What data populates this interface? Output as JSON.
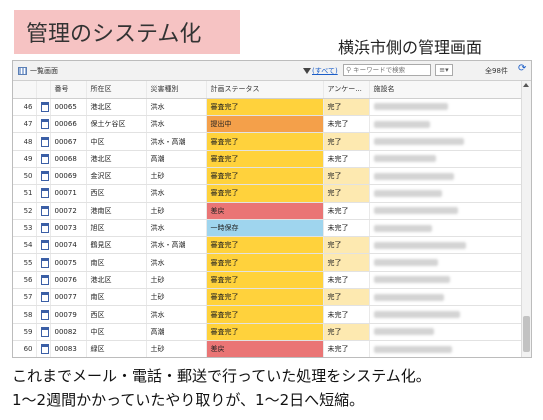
{
  "title": "管理のシステム化",
  "subtitle": "横浜市側の管理画面",
  "toolbar": {
    "list_label": "一覧画面",
    "filter_label": "(すべて)",
    "search_placeholder": "キーワードで検索",
    "menu_icon": "≡▾",
    "count": "全98件",
    "refresh_icon": "C"
  },
  "table": {
    "columns": [
      "",
      "",
      "番号",
      "所在区",
      "災害種別",
      "計画ステータス",
      "アンケー...",
      "施設名"
    ],
    "rows": [
      {
        "n": "46",
        "no": "00065",
        "ward": "港北区",
        "type": "洪水",
        "status": "審査完了",
        "status_color": "yellow",
        "survey": "完了",
        "survey_color": "yellow"
      },
      {
        "n": "47",
        "no": "00066",
        "ward": "保土ケ谷区",
        "type": "洪水",
        "status": "提出中",
        "status_color": "orange",
        "survey": "未完了",
        "survey_color": "none"
      },
      {
        "n": "48",
        "no": "00067",
        "ward": "中区",
        "type": "洪水・高潮",
        "status": "審査完了",
        "status_color": "yellow",
        "survey": "完了",
        "survey_color": "yellow"
      },
      {
        "n": "49",
        "no": "00068",
        "ward": "港北区",
        "type": "高潮",
        "status": "審査完了",
        "status_color": "yellow",
        "survey": "未完了",
        "survey_color": "none"
      },
      {
        "n": "50",
        "no": "00069",
        "ward": "金沢区",
        "type": "土砂",
        "status": "審査完了",
        "status_color": "yellow",
        "survey": "完了",
        "survey_color": "yellow"
      },
      {
        "n": "51",
        "no": "00071",
        "ward": "西区",
        "type": "洪水",
        "status": "審査完了",
        "status_color": "yellow",
        "survey": "完了",
        "survey_color": "yellow"
      },
      {
        "n": "52",
        "no": "00072",
        "ward": "港南区",
        "type": "土砂",
        "status": "差戻",
        "status_color": "red",
        "survey": "未完了",
        "survey_color": "none"
      },
      {
        "n": "53",
        "no": "00073",
        "ward": "旭区",
        "type": "洪水",
        "status": "一時保存",
        "status_color": "blue",
        "survey": "未完了",
        "survey_color": "none"
      },
      {
        "n": "54",
        "no": "00074",
        "ward": "鶴見区",
        "type": "洪水・高潮",
        "status": "審査完了",
        "status_color": "yellow",
        "survey": "完了",
        "survey_color": "yellow"
      },
      {
        "n": "55",
        "no": "00075",
        "ward": "南区",
        "type": "洪水",
        "status": "審査完了",
        "status_color": "yellow",
        "survey": "完了",
        "survey_color": "yellow"
      },
      {
        "n": "56",
        "no": "00076",
        "ward": "港北区",
        "type": "土砂",
        "status": "審査完了",
        "status_color": "yellow",
        "survey": "未完了",
        "survey_color": "none"
      },
      {
        "n": "57",
        "no": "00077",
        "ward": "南区",
        "type": "土砂",
        "status": "審査完了",
        "status_color": "yellow",
        "survey": "完了",
        "survey_color": "yellow"
      },
      {
        "n": "58",
        "no": "00079",
        "ward": "西区",
        "type": "洪水",
        "status": "審査完了",
        "status_color": "yellow",
        "survey": "未完了",
        "survey_color": "none"
      },
      {
        "n": "59",
        "no": "00082",
        "ward": "中区",
        "type": "高潮",
        "status": "審査完了",
        "status_color": "yellow",
        "survey": "完了",
        "survey_color": "yellow"
      },
      {
        "n": "60",
        "no": "00083",
        "ward": "緑区",
        "type": "土砂",
        "status": "差戻",
        "status_color": "red",
        "survey": "未完了",
        "survey_color": "none"
      }
    ]
  },
  "caption": {
    "line1": "これまでメール・電話・郵送で行っていた処理をシステム化。",
    "line2": "1～2週間かかっていたやり取りが、1～2日へ短縮。"
  }
}
